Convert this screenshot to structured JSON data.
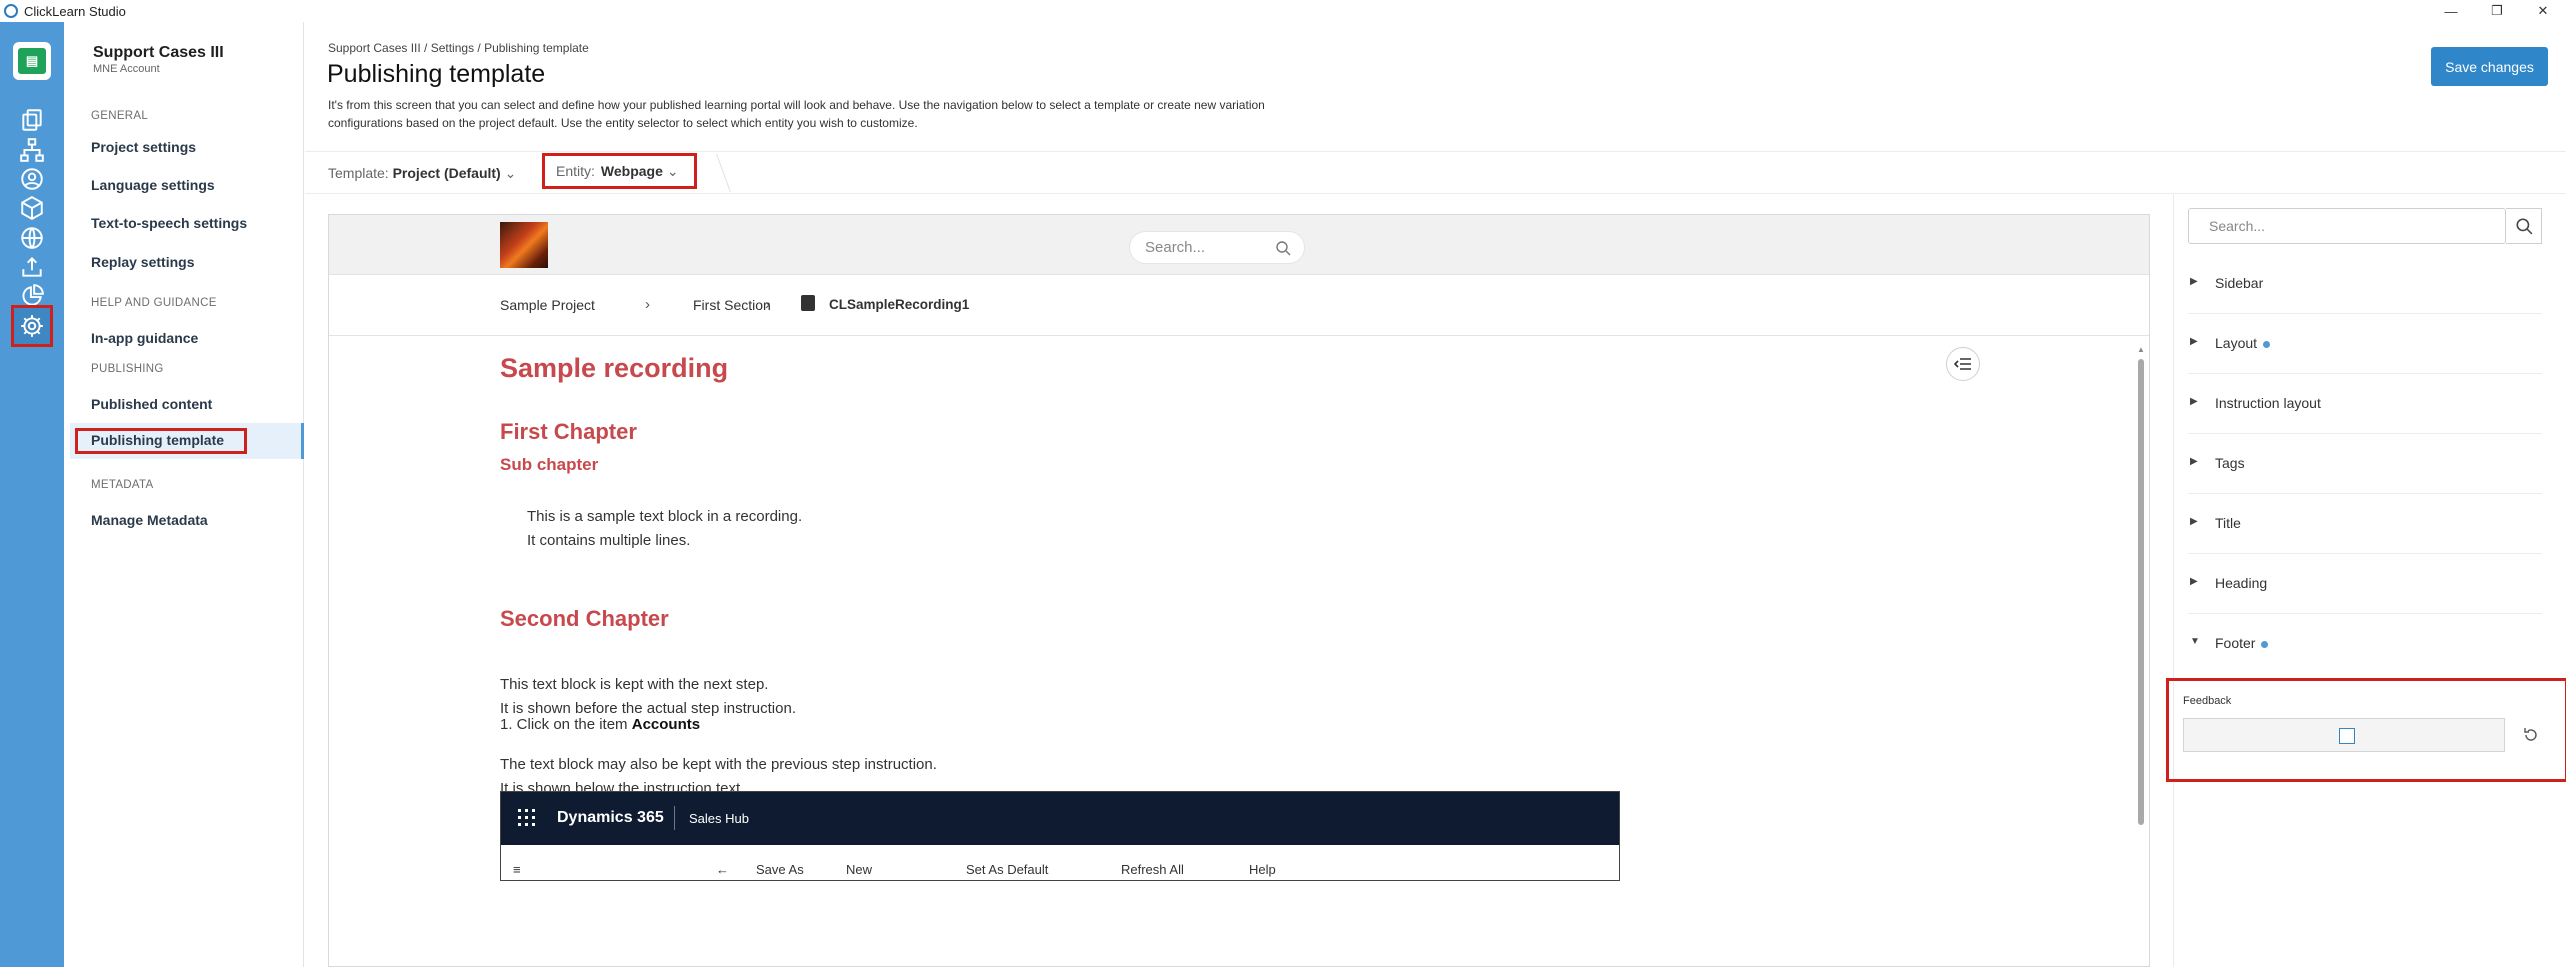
{
  "window": {
    "title": "ClickLearn Studio",
    "min": "—",
    "restore": "❐",
    "close": "✕"
  },
  "nav": {
    "project_title": "Support Cases III",
    "project_sub": "MNE Account",
    "sections": {
      "general": "GENERAL",
      "help": "HELP AND GUIDANCE",
      "publishing": "PUBLISHING",
      "metadata": "METADATA"
    },
    "items": {
      "project_settings": "Project settings",
      "language_settings": "Language settings",
      "tts_settings": "Text-to-speech settings",
      "replay_settings": "Replay settings",
      "inapp_guidance": "In-app guidance",
      "published_content": "Published content",
      "publishing_template": "Publishing template",
      "manage_metadata": "Manage Metadata"
    }
  },
  "header": {
    "breadcrumb": "Support Cases III / Settings / Publishing template",
    "title": "Publishing template",
    "description": "It's from this screen that you can select and define how your published learning portal will look and behave. Use the navigation below to select a template or create new variation configurations based on the project default. Use the entity selector to select which entity you wish to customize.",
    "save_label": "Save changes"
  },
  "selector": {
    "template_label": "Template:",
    "template_value": "Project (Default)",
    "entity_label": "Entity:",
    "entity_value": "Webpage"
  },
  "preview": {
    "search_placeholder": "Search...",
    "crumbs": [
      "Sample Project",
      "First Section",
      "CLSampleRecording1"
    ],
    "recording_title": "Sample recording",
    "chapter1": "First Chapter",
    "subchapter": "Sub chapter",
    "block1_line1": "This is a sample text block in a recording.",
    "block1_line2": "It contains multiple lines.",
    "chapter2": "Second Chapter",
    "block2_line1": "This text block is kept with the next step.",
    "block2_line2": "It is shown before the actual step instruction.",
    "step_prefix": "1. Click on the item",
    "step_item": "Accounts",
    "block3_line1": "The text block may also be kept with the previous step instruction.",
    "block3_line2": "It is shown below the instruction text.",
    "d365": {
      "app": "Dynamics 365",
      "hub": "Sales Hub",
      "cmd": [
        "Save As",
        "New",
        "Set As Default",
        "Refresh All",
        "Help"
      ]
    }
  },
  "right_panel": {
    "search_placeholder": "Search...",
    "sections": [
      "Sidebar",
      "Layout",
      "Instruction layout",
      "Tags",
      "Title",
      "Heading",
      "Footer"
    ],
    "feedback_label": "Feedback",
    "accent": "#4f9ad6"
  },
  "colors": {
    "rail": "#4f9ad6",
    "primary_button": "#2f86c8",
    "heading_red": "#c8494d",
    "highlight_red": "#d0201c",
    "d365_bar": "#0e1b30"
  }
}
